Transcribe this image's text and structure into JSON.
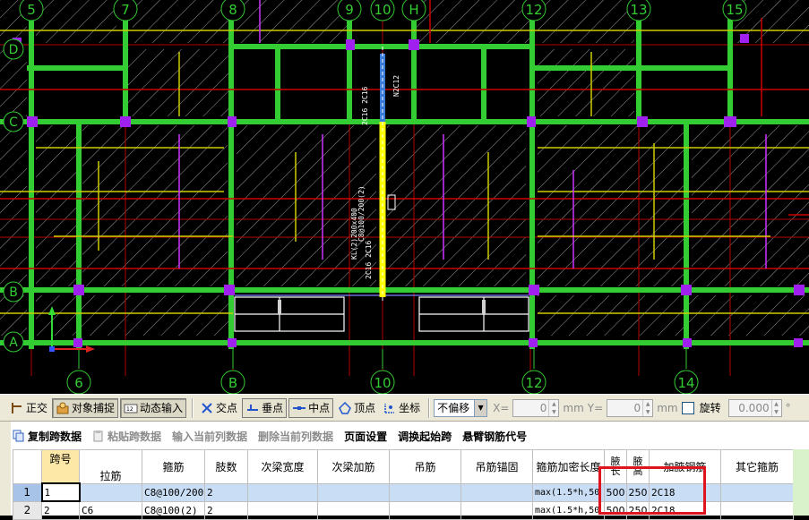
{
  "cad": {
    "axis_top": [
      "5",
      "7",
      "8",
      "9",
      "10",
      "H",
      "12",
      "13",
      "15"
    ],
    "axis_bottom": [
      "6",
      "B",
      "10",
      "12",
      "14"
    ],
    "axis_left": [
      "D",
      "C",
      "B",
      "A"
    ],
    "beam_annotations": [
      "KL(2)200x400",
      "C8@100/200(2)",
      "2C16 2C16",
      "2C16 2C16",
      "N2C12"
    ],
    "colors": {
      "background": "#000000",
      "beam": "#33cc33",
      "selected_beam": "#ffff00",
      "rebar": "#cc33ff",
      "axis": "#cc0000",
      "column": "#cc33ff"
    }
  },
  "snapbar": {
    "ortho": "正交",
    "object_snap": "对象捕捉",
    "dynamic_input": "动态输入",
    "intersection": "交点",
    "perpendicular": "垂点",
    "midpoint": "中点",
    "vertex": "顶点",
    "coordinate": "坐标",
    "offset_mode": "不偏移",
    "x_label": "X=",
    "x_value": "0",
    "x_unit": "mm",
    "y_label": "Y=",
    "y_value": "0",
    "y_unit": "mm",
    "rotate_label": "旋转",
    "rotate_value": "0.000",
    "degree": "°"
  },
  "panel": {
    "toolbar": {
      "copy_span": "复制跨数据",
      "paste_span": "粘贴跨数据",
      "input_column": "输入当前列数据",
      "delete_column": "删除当前列数据",
      "page_setup": "页面设置",
      "swap_start": "调换起始跨",
      "cantilever_code": "悬臂钢筋代号"
    },
    "headers": {
      "span_no": "跨号",
      "tie": "拉筋",
      "stirrup": "箍筋",
      "legs": "肢数",
      "sec_beam_width": "次梁宽度",
      "sec_beam_rebar": "次梁加筋",
      "hanger": "吊筋",
      "hanger_anchor": "吊筋锚固",
      "stirrup_dense_len": "箍筋加密长度",
      "haunch_len": "腋长",
      "haunch_height": "腋高",
      "haunch_rebar": "加腋钢筋",
      "other_stirrup": "其它箍筋"
    },
    "rows": [
      {
        "num": "1",
        "span_no": "1",
        "tie": "",
        "stirrup": "C8@100/200(",
        "legs": "2",
        "sec_beam_width": "",
        "sec_beam_rebar": "",
        "hanger": "",
        "hanger_anchor": "",
        "dense_len": "max(1.5*h,50",
        "haunch_len": "500",
        "haunch_height": "250",
        "haunch_rebar": "2C18",
        "other": ""
      },
      {
        "num": "2",
        "span_no": "2",
        "tie": "C6",
        "stirrup": "C8@100(2)",
        "legs": "2",
        "sec_beam_width": "",
        "sec_beam_rebar": "",
        "hanger": "",
        "hanger_anchor": "",
        "dense_len": "max(1.5*h,50",
        "haunch_len": "500",
        "haunch_height": "250",
        "haunch_rebar": "2C18",
        "other": ""
      }
    ]
  }
}
